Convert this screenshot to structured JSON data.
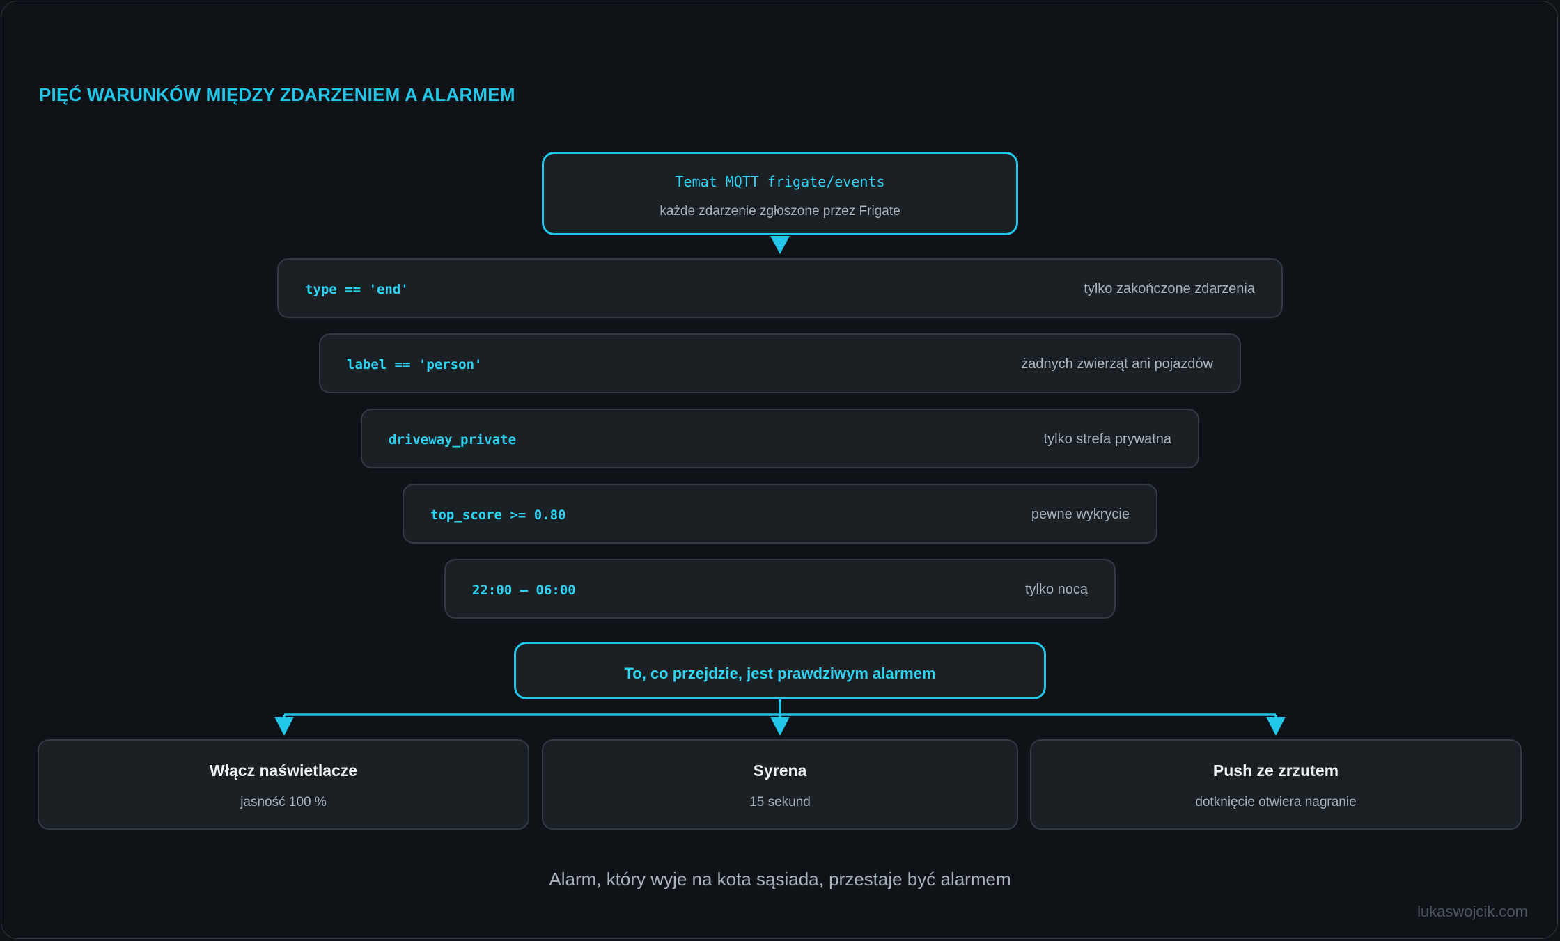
{
  "title": "PIĘĆ WARUNKÓW MIĘDZY ZDARZENIEM A ALARMEM",
  "source": {
    "title": "Temat MQTT frigate/events",
    "subtitle": "każde zdarzenie zgłoszone przez Frigate"
  },
  "conditions": [
    {
      "code": "type == 'end'",
      "description": "tylko zakończone zdarzenia"
    },
    {
      "code": "label == 'person'",
      "description": "żadnych zwierząt ani pojazdów"
    },
    {
      "code": "driveway_private",
      "description": "tylko strefa prywatna"
    },
    {
      "code": "top_score >= 0.80",
      "description": "pewne wykrycie"
    },
    {
      "code": "22:00 – 06:00",
      "description": "tylko nocą"
    }
  ],
  "result": {
    "label": "To, co przejdzie, jest prawdziwym alarmem"
  },
  "outputs": [
    {
      "title": "Włącz naświetlacze",
      "subtitle": "jasność 100 %"
    },
    {
      "title": "Syrena",
      "subtitle": "15 sekund"
    },
    {
      "title": "Push ze zrzutem",
      "subtitle": "dotknięcie otwiera nagranie"
    }
  ],
  "footer": "Alarm, który wyje na kota sąsiada, przestaje być alarmem",
  "watermark": "lukaswojcik.com",
  "colors": {
    "background": "#0f1317",
    "accent": "#22c6e8",
    "box": "#1b2025",
    "border": "#323a44",
    "muted_text": "#a9b3bd"
  }
}
